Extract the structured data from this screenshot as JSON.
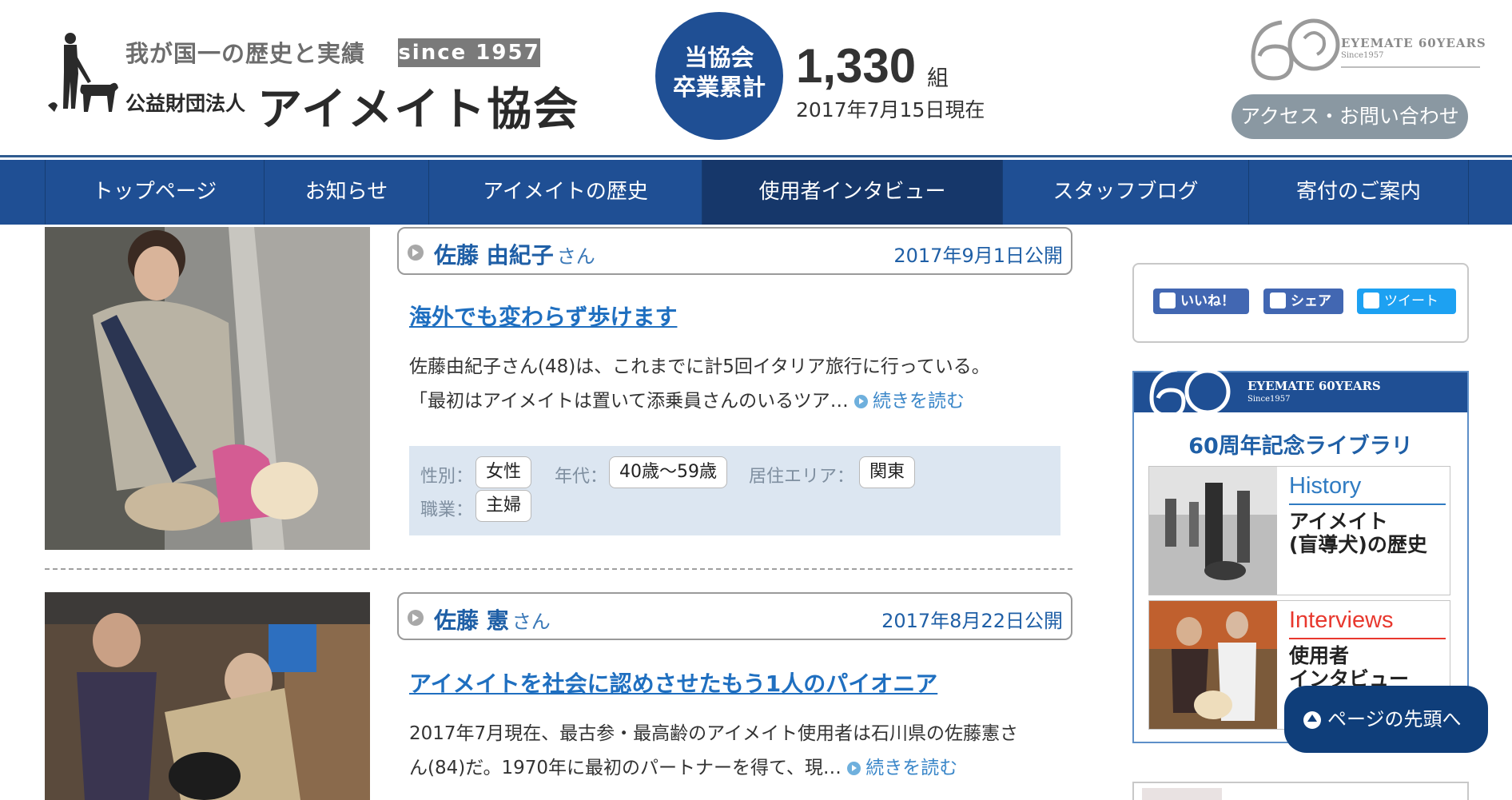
{
  "header": {
    "tagline": "我が国一の歴史と実績",
    "since": "since 1957",
    "org_prefix": "公益財団法人",
    "org_name": "アイメイト協会",
    "graduates": {
      "circle_line1": "当協会",
      "circle_line2": "卒業累計",
      "count": "1,330",
      "unit": "組",
      "as_of": "2017年7月15日現在"
    },
    "anniversary": {
      "text": "EYEMATE 60YEARS",
      "sub": "Since1957"
    },
    "access_button": "アクセス・お問い合わせ"
  },
  "nav": {
    "items": [
      {
        "label": "トップページ"
      },
      {
        "label": "お知らせ"
      },
      {
        "label": "アイメイトの歴史"
      },
      {
        "label": "使用者インタビュー"
      },
      {
        "label": "スタッフブログ"
      },
      {
        "label": "寄付のご案内"
      }
    ]
  },
  "interviews": [
    {
      "name": "佐藤 由紀子",
      "honorific": "さん",
      "date": "2017年9月1日公開",
      "title": "海外でも変わらず歩けます",
      "excerpt_line1": "佐藤由紀子さん(48)は、これまでに計5回イタリア旅行に行っている。",
      "excerpt_line2": "「最初はアイメイトは置いて添乗員さんのいるツア…",
      "read_more": "続きを読む",
      "tags": {
        "gender_label": "性別：",
        "gender": "女性",
        "age_label": "年代：",
        "age": "40歳～59歳",
        "area_label": "居住エリア：",
        "area": "関東",
        "job_label": "職業：",
        "job": "主婦"
      }
    },
    {
      "name": "佐藤 憲",
      "honorific": "さん",
      "date": "2017年8月22日公開",
      "title": "アイメイトを社会に認めさせたもう1人のパイオニア",
      "excerpt_line1": "2017年7月現在、最古参・最高齢のアイメイト使用者は石川県の佐藤憲さ",
      "excerpt_line2": "ん(84)だ。1970年に最初のパートナーを得て、現…",
      "read_more": "続きを読む"
    }
  ],
  "sidebar": {
    "social": {
      "like": "いいね！",
      "share": "シェア",
      "tweet": "ツイート"
    },
    "library": {
      "banner_text": "EYEMATE 60YEARS",
      "banner_sub": "Since1957",
      "title": "60周年記念ライブラリ",
      "items": [
        {
          "en": "History",
          "jp_line1": "アイメイト",
          "jp_line2": "(盲導犬)の歴史"
        },
        {
          "en": "Interviews",
          "jp_line1": "使用者",
          "jp_line2": "インタビュー"
        }
      ]
    },
    "back_to_top": "ページの先頭へ"
  },
  "colors": {
    "brand_blue": "#1f4f94",
    "link_blue": "#1f6fc0",
    "accent_red": "#e8382e",
    "history_blue": "#2f7bc2"
  }
}
